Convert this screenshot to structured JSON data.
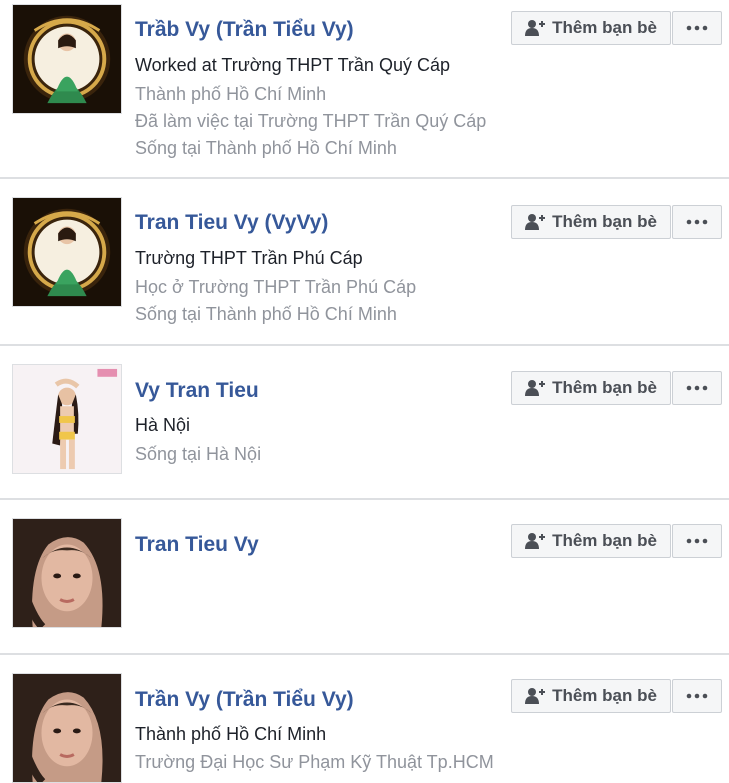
{
  "results": [
    {
      "name": "Trầb Vy (Trần Tiểu Vy)",
      "lines": [
        "Worked at Trường THPT Trần Quý Cáp",
        "Thành phố Hồ Chí Minh",
        "Đã làm việc tại Trường THPT Trần Quý Cáp",
        "Sống tại Thành phố Hồ Chí Minh"
      ],
      "add_label": "Thêm bạn bè"
    },
    {
      "name": "Tran Tieu Vy (VyVy)",
      "lines": [
        "Trường THPT Trần Phú Cáp",
        "Học ở Trường THPT Trần Phú Cáp",
        "Sống tại Thành phố Hồ Chí Minh"
      ],
      "add_label": "Thêm bạn bè"
    },
    {
      "name": "Vy Tran Tieu",
      "lines": [
        "Hà Nội",
        "Sống tại Hà Nội"
      ],
      "add_label": "Thêm bạn bè"
    },
    {
      "name": "Tran Tieu Vy",
      "lines": [],
      "add_label": "Thêm bạn bè"
    },
    {
      "name": "Trần Vy (Trần Tiểu Vy)",
      "lines": [
        "Thành phố Hồ Chí Minh",
        "Trường Đại Học Sư Phạm Kỹ Thuật Tp.HCM"
      ],
      "add_label": "Thêm bạn bè"
    }
  ],
  "colors": {
    "name_link": "#365899",
    "primary_text": "#1d2129",
    "secondary_text": "#90949c",
    "divider": "#dddfe2",
    "button_bg": "#f5f6f7"
  },
  "icons": {
    "add_friend": "add-friend-icon",
    "more": "more-options-icon"
  }
}
